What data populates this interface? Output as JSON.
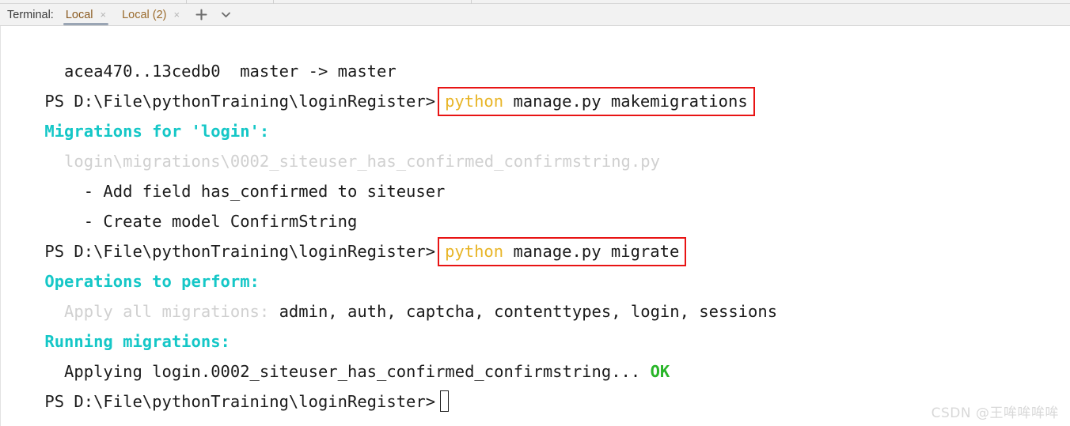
{
  "tabbar": {
    "label": "Terminal:",
    "tabs": [
      {
        "name": "Local",
        "close": "×",
        "active": true
      },
      {
        "name": "Local (2)",
        "close": "×",
        "active": false
      }
    ],
    "add_button": "+",
    "dropdown_button": "ˇ"
  },
  "terminal": {
    "prompt": "PS D:\\File\\pythonTraining\\loginRegister>",
    "lines": [
      {
        "id": "push-result",
        "text": "  acea470..13cedb0  master -> master"
      },
      {
        "id": "prompt-1"
      },
      {
        "id": "migrations-for",
        "text": "Migrations for 'login':"
      },
      {
        "id": "migration-file",
        "text": "  login\\migrations\\0002_siteuser_has_confirmed_confirmstring.py"
      },
      {
        "id": "op-add-field",
        "text": "    - Add field has_confirmed to siteuser"
      },
      {
        "id": "op-create-model",
        "text": "    - Create model ConfirmString"
      },
      {
        "id": "prompt-2"
      },
      {
        "id": "operations-header",
        "text": "Operations to perform:"
      },
      {
        "id": "apply-all",
        "label": "  Apply all migrations:",
        "apps": " admin, auth, captcha, contenttypes, login, sessions"
      },
      {
        "id": "running-header",
        "text": "Running migrations:"
      },
      {
        "id": "applying",
        "text": "  Applying login.0002_siteuser_has_confirmed_confirmstring...",
        "status": "OK"
      },
      {
        "id": "prompt-3"
      }
    ],
    "commands": {
      "makemigrations": {
        "keyword": "python",
        "args": " manage.py makemigrations"
      },
      "migrate": {
        "keyword": "python",
        "args": " manage.py migrate"
      }
    }
  },
  "watermark": "CSDN @王哞哞哞哞",
  "colors": {
    "cyan": "#15c7c7",
    "green": "#28b528",
    "yellow": "#e8b528",
    "grey": "#d0d0d0",
    "highlight_border": "#e81414",
    "tab_text": "#9a6a2b",
    "tab_underline": "#9aa5b4"
  }
}
